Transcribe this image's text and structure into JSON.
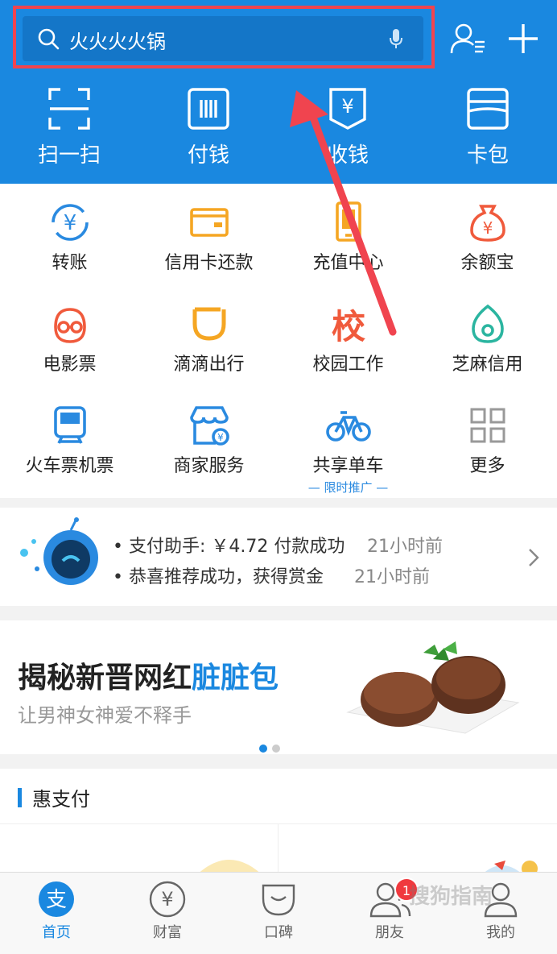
{
  "search": {
    "query": "火火火火锅"
  },
  "quick_actions": [
    {
      "label": "扫一扫",
      "icon": "scan-icon"
    },
    {
      "label": "付钱",
      "icon": "pay-barcode-icon"
    },
    {
      "label": "收钱",
      "icon": "receive-money-icon"
    },
    {
      "label": "卡包",
      "icon": "card-wallet-icon"
    }
  ],
  "services": [
    {
      "label": "转账",
      "icon": "transfer-icon",
      "color": "#2a8ae0"
    },
    {
      "label": "信用卡还款",
      "icon": "credit-card-icon",
      "color": "#f5a623"
    },
    {
      "label": "充值中心",
      "icon": "phone-topup-icon",
      "color": "#f5a623"
    },
    {
      "label": "余额宝",
      "icon": "money-bag-icon",
      "color": "#f05a3c"
    },
    {
      "label": "电影票",
      "icon": "movie-mascot-icon",
      "color": "#f05a3c"
    },
    {
      "label": "滴滴出行",
      "icon": "didi-icon",
      "color": "#f5a623"
    },
    {
      "label": "校园工作",
      "icon": "campus-icon",
      "icon_text": "校",
      "color": "#f05a3c"
    },
    {
      "label": "芝麻信用",
      "icon": "sesame-credit-icon",
      "color": "#2bb5a0"
    },
    {
      "label": "火车票机票",
      "icon": "train-icon",
      "color": "#2a8ae0"
    },
    {
      "label": "商家服务",
      "icon": "shop-icon",
      "color": "#2a8ae0"
    },
    {
      "label": "共享单车",
      "icon": "bicycle-icon",
      "promo": "— 限时推广 —",
      "color": "#2a8ae0"
    },
    {
      "label": "更多",
      "icon": "more-grid-icon",
      "color": "#999999"
    }
  ],
  "notifications": [
    {
      "text": "• 支付助手: ￥4.72 付款成功",
      "time": "21小时前"
    },
    {
      "text": "• 恭喜推荐成功，获得赏金",
      "time": "21小时前"
    }
  ],
  "banner": {
    "title_part1": "揭秘新晋网红",
    "title_part2": "脏脏包",
    "subtitle": "让男神女神爱不释手"
  },
  "section": {
    "title": "惠支付"
  },
  "tabs": [
    {
      "label": "首页",
      "icon": "home-icon",
      "icon_text": "支"
    },
    {
      "label": "财富",
      "icon": "wealth-icon",
      "icon_text": "¥"
    },
    {
      "label": "口碑",
      "icon": "koubei-icon"
    },
    {
      "label": "朋友",
      "icon": "friends-icon",
      "badge": "1"
    },
    {
      "label": "我的",
      "icon": "profile-icon"
    }
  ],
  "watermark": "搜狗指南",
  "colors": {
    "brand_blue": "#1a88e0",
    "highlight_red": "#f0444f"
  }
}
